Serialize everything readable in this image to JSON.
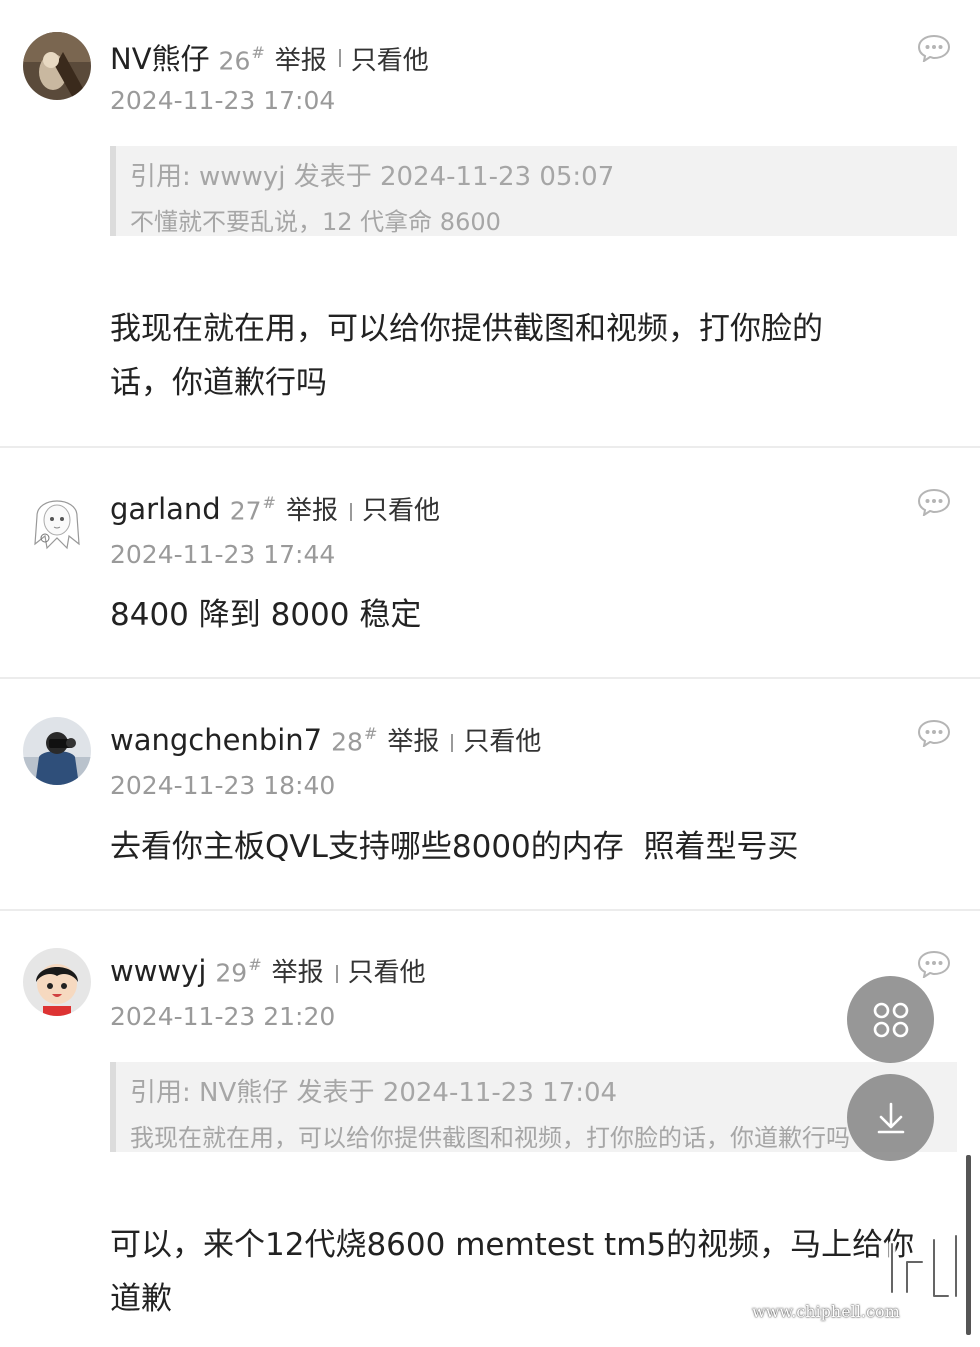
{
  "posts": [
    {
      "username": "NV熊仔",
      "floor": "26",
      "floor_mark": "#",
      "report": "举报",
      "only_view": "只看他",
      "time": "2024-11-23 17:04",
      "quote": {
        "line1": "引用: wwwyj 发表于 2024-11-23 05:07",
        "line2": "不懂就不要乱说，12 代拿命 8600"
      },
      "content_lines": [
        "我现在就在用，可以给你提供截图和视频，打你脸的",
        "话，你道歉行吗"
      ]
    },
    {
      "username": "garland",
      "floor": "27",
      "floor_mark": "#",
      "report": "举报",
      "only_view": "只看他",
      "time": "2024-11-23 17:44",
      "content_lines": [
        "8400 降到 8000 稳定"
      ]
    },
    {
      "username": "wangchenbin7",
      "floor": "28",
      "floor_mark": "#",
      "report": "举报",
      "only_view": "只看他",
      "time": "2024-11-23 18:40",
      "content_lines": [
        "去看你主板QVL支持哪些8000的内存  照着型号买"
      ]
    },
    {
      "username": "wwwyj",
      "floor": "29",
      "floor_mark": "#",
      "report": "举报",
      "only_view": "只看他",
      "time": "2024-11-23 21:20",
      "quote": {
        "line1": "引用: NV熊仔 发表于 2024-11-23 17:04",
        "line2": "我现在就在用，可以给你提供截图和视频，打你脸的话，你道歉行吗"
      },
      "content_lines": [
        "可以，来个12代烧8600 memtest tm5的视频，马上给你",
        "道歉"
      ]
    }
  ],
  "icons": {
    "reply": "comment-bubble-icon",
    "menu_fab": "grid-menu-icon",
    "download_fab": "arrow-down-icon"
  },
  "watermark": {
    "text": "www.chiphell.com",
    "logo": "chiphell"
  },
  "colors": {
    "text": "#222222",
    "muted": "#9a9a9a",
    "quote_bg": "#f2f2f2",
    "fab_bg": "#808080"
  }
}
